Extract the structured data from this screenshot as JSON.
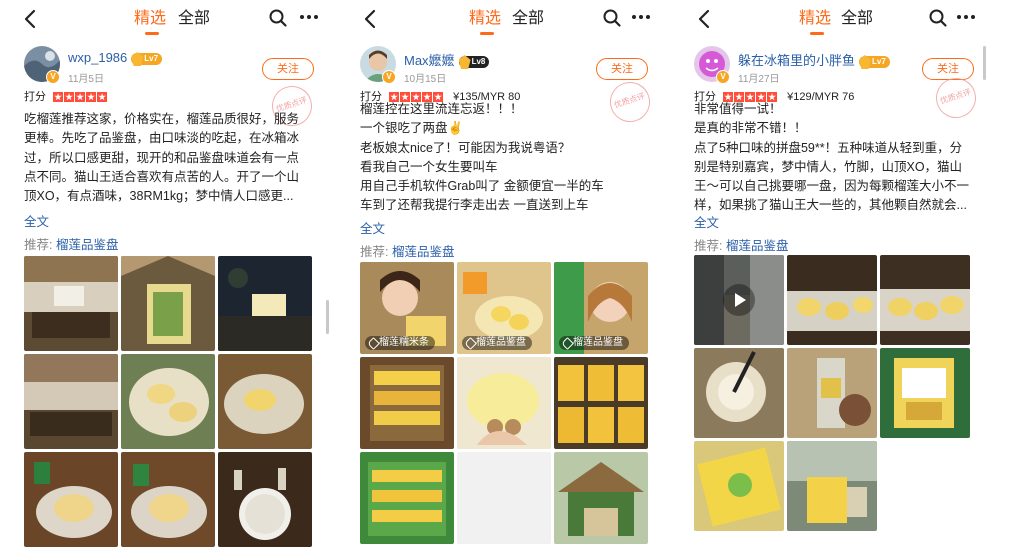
{
  "colors": {
    "accent": "#ff6a1a",
    "link": "#2a5fa8",
    "star": "#ff4d3a"
  },
  "header": {
    "tab_featured": "精选",
    "tab_all": "全部"
  },
  "common": {
    "follow_label": "关注",
    "score_label": "打分",
    "fulltext_label": "全文",
    "recommend_prefix": "推荐:",
    "stamp_text": "优质点评"
  },
  "panels": [
    {
      "username": "wxp_1986",
      "level": "Lv7",
      "date": "11月5日",
      "rating": 5,
      "price": "",
      "lines": [
        "吃榴莲推荐这家，价格实在，榴莲品质很好，服务",
        "更棒。先吃了品鉴盘，由口味淡的吃起，在冰箱冰",
        "过，所以口感更甜，现开的和品鉴盘味道会有一点",
        "点不同。猫山王适合喜欢有点苦的人。开了一个山",
        "顶XO，有点酒味，38RM1kg；梦中情人口感更..."
      ],
      "recommend": "榴莲品鉴盘",
      "photos": [
        {
          "kind": "restaurant"
        },
        {
          "kind": "stall"
        },
        {
          "kind": "night"
        },
        {
          "kind": "restaurant"
        },
        {
          "kind": "durian"
        },
        {
          "kind": "durian2"
        },
        {
          "kind": "plate"
        },
        {
          "kind": "plate"
        },
        {
          "kind": "bowl"
        }
      ]
    },
    {
      "username": "Max嬷嬷",
      "level": "Lv8",
      "date": "10月15日",
      "rating": 5,
      "price": "¥135/MYR 80",
      "lines": [
        "榴莲控在这里流连忘返！！！",
        "一个银吃了两盘✌️",
        "老板娘太nice了！可能因为我说粤语？",
        "看我自己一个女生要叫车",
        "用自己手机软件Grab叫了 金额便宜一半的车",
        "车到了还帮我提行李走出去 一直送到上车"
      ],
      "recommend": "榴莲品鉴盘",
      "photos": [
        {
          "kind": "selfie",
          "tag": "榴莲糯米条"
        },
        {
          "kind": "yellow",
          "tag": "榴莲品鉴盘"
        },
        {
          "kind": "selfie2",
          "tag": "榴莲品鉴盘"
        },
        {
          "kind": "shelf"
        },
        {
          "kind": "hand"
        },
        {
          "kind": "packs"
        },
        {
          "kind": "shelf2"
        },
        {
          "kind": "blank"
        },
        {
          "kind": "hut"
        }
      ]
    },
    {
      "username": "躲在冰箱里的小胖鱼",
      "level": "Lv7",
      "date": "11月27日",
      "rating": 5,
      "price": "¥129/MYR 76",
      "lines": [
        "非常值得一试！",
        "是真的非常不错！！",
        "点了5种口味的拼盘59**！五种味道从轻到重，分",
        "别是特别嘉宾，梦中情人，竹脚，山顶XO，猫山",
        "王～可以自己挑要哪一盘，因为每颗榴莲大小不一",
        "样，如果挑了猫山王大一些的，其他颗自然就会..."
      ],
      "recommend": "榴莲品鉴盘",
      "photos": [
        {
          "kind": "video"
        },
        {
          "kind": "tray"
        },
        {
          "kind": "tray"
        },
        {
          "kind": "coconut"
        },
        {
          "kind": "drinks"
        },
        {
          "kind": "greenpack"
        },
        {
          "kind": "yellowpack"
        },
        {
          "kind": "outdoor"
        }
      ]
    }
  ]
}
